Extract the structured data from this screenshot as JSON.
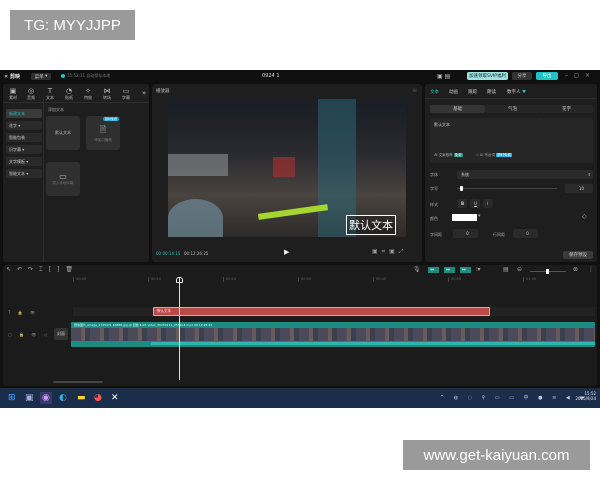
{
  "watermarks": {
    "top_left": "TG: MYYJJPP",
    "bottom_right": "www.get-kaiyuan.com"
  },
  "titlebar": {
    "app_name": "剪映",
    "menu": "菜单",
    "autosave": "15:52:11 自动保存本地",
    "project_title": "0924 1",
    "svip_button": "加速领取SVIP福利",
    "share": "分享",
    "export": "导出"
  },
  "left_toolbar": [
    {
      "icon": "media-icon",
      "label": "素材"
    },
    {
      "icon": "audio-icon",
      "label": "音频"
    },
    {
      "icon": "text-icon",
      "label": "文本",
      "active": true
    },
    {
      "icon": "sticker-icon",
      "label": "贴纸"
    },
    {
      "icon": "effects-icon",
      "label": "特效"
    },
    {
      "icon": "transition-icon",
      "label": "转场"
    },
    {
      "icon": "caption-icon",
      "label": "字幕"
    }
  ],
  "left_sidebar": [
    {
      "label": "新建文本",
      "active": true
    },
    {
      "label": "花字"
    },
    {
      "label": "智能包装"
    },
    {
      "label": "识字幕"
    },
    {
      "label": "文字模板"
    },
    {
      "label": "智能文本"
    }
  ],
  "text_section_title": "添加文本",
  "cards": [
    {
      "label": "默认文本"
    },
    {
      "label": "添加口播稿",
      "badge": "限时免费"
    },
    {
      "label": "导入本地字幕"
    }
  ],
  "player": {
    "title": "播放器",
    "current_time": "00:00:14:15",
    "total_time": "00:12:26:25",
    "overlay_text": "默认文本"
  },
  "inspector": {
    "tabs": [
      "文本",
      "动画",
      "跟踪",
      "朗读",
      "数字人"
    ],
    "active_tab": "文本",
    "subtabs": [
      "基础",
      "气泡",
      "花字"
    ],
    "active_subtab": "基础",
    "text_value": "默认文本",
    "recommend": "文案推荐",
    "recommend_badge": "免费",
    "ai": "AI 写台词",
    "ai_badge": "限时免费",
    "font_label": "字体",
    "font_value": "系统",
    "size_label": "字号",
    "size_value": "10",
    "size_fraction": 0.03,
    "style_label": "样式",
    "styles": [
      "B",
      "U",
      "I"
    ],
    "color_label": "颜色",
    "color_value": "#ffffff",
    "letter_spacing_label": "字间距",
    "letter_spacing": "0",
    "line_spacing_label": "行间距",
    "line_spacing": "0",
    "save_preset": "保存预设"
  },
  "timeline": {
    "ruler": [
      "00:00",
      "00:10",
      "00:20",
      "00:30",
      "00:40",
      "00:50",
      "01:00"
    ],
    "text_clip": "默认文本",
    "cover_label": "封面",
    "main_clip_label": "微信图片_image_1735371 40888.jpg  @ 回放 4.0X  video_20250111_255914.mp4  00:12:25:25",
    "zoom_fraction": 0.45
  },
  "taskbar": {
    "time": "15:52",
    "date": "2025/9/24"
  },
  "colors": {
    "accent": "#22c1c3",
    "text_clip": "#b84a47",
    "video_track": "#1d8a84",
    "taskbar": "#1a2d4a"
  }
}
